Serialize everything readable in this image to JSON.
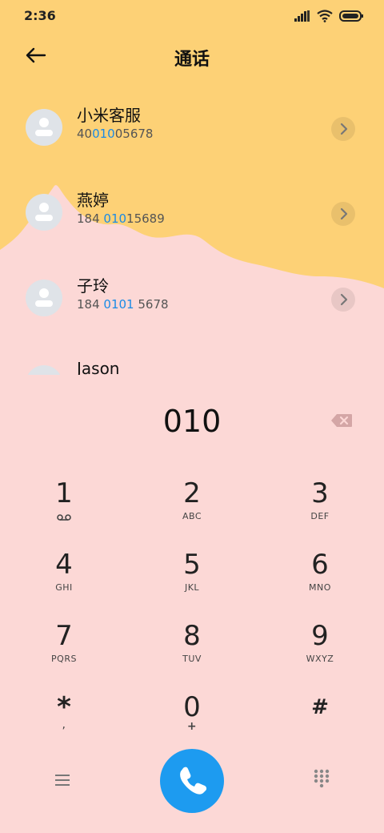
{
  "status": {
    "time": "2:36"
  },
  "header": {
    "title": "通话"
  },
  "contacts": [
    {
      "name": "小米客服",
      "num_pre": "40",
      "num_hl": "010",
      "num_post": "05678"
    },
    {
      "name": "燕婷",
      "num_pre": "184 ",
      "num_hl": "010",
      "num_post": "15689"
    },
    {
      "name": "子玲",
      "num_pre": "184 ",
      "num_hl": "0101",
      "num_post": " 5678"
    },
    {
      "name": "Jason"
    }
  ],
  "dialer": {
    "entry": "010",
    "keys": [
      {
        "digit": "1",
        "letters": ""
      },
      {
        "digit": "2",
        "letters": "ABC"
      },
      {
        "digit": "3",
        "letters": "DEF"
      },
      {
        "digit": "4",
        "letters": "GHI"
      },
      {
        "digit": "5",
        "letters": "JKL"
      },
      {
        "digit": "6",
        "letters": "MNO"
      },
      {
        "digit": "7",
        "letters": "PQRS"
      },
      {
        "digit": "8",
        "letters": "TUV"
      },
      {
        "digit": "9",
        "letters": "WXYZ"
      },
      {
        "digit": "*",
        "letters": ","
      },
      {
        "digit": "0",
        "letters": "+"
      },
      {
        "digit": "#",
        "letters": ""
      }
    ]
  },
  "colors": {
    "accent": "#1d9bf0",
    "yellow_bg": "#fdd176",
    "pink_bg": "#fcd8d6",
    "highlight": "#1a8be6"
  }
}
